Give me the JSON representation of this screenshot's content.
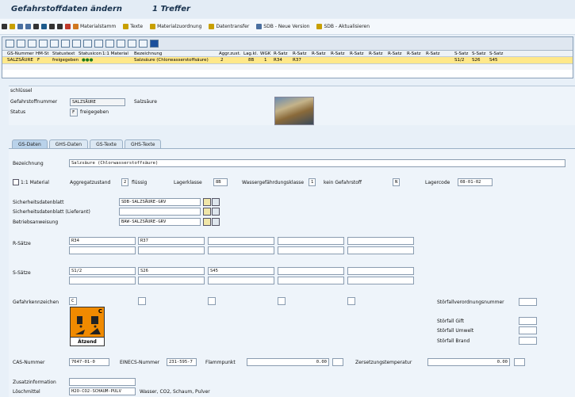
{
  "title": {
    "main": "Gefahrstoffdaten ändern",
    "count": "1 Treffer"
  },
  "toolbar": {
    "materialstamm": "Materialstamm",
    "texte": "Texte",
    "materialzuordnung": "Materialzuordnung",
    "datentransfer": "Datentransfer",
    "sdb_neue": "SDB - Neue Version",
    "sdb_akt": "SDB - Aktualisieren"
  },
  "grid": {
    "headers": [
      "GS-Nummer",
      "HM-St",
      "Statustext",
      "Statusicon",
      "1:1 Material",
      "Bezeichnung",
      "Aggr.zust.",
      "Lag.kl.",
      "WGK",
      "R-Satz",
      "R-Satz",
      "R-Satz",
      "R-Satz",
      "R-Satz",
      "R-Satz",
      "R-Satz",
      "R-Satz",
      "R-Satz",
      "S-Satz",
      "S-Satz",
      "S-Satz"
    ],
    "row": {
      "gs": "SALZSÄURE",
      "hm": "F",
      "status": "freigegeben",
      "bez": "Salzsäure (Chlorwasserstoffsäure)",
      "aggr": "2",
      "lag": "8B",
      "wgk": "1",
      "r1": "R34",
      "r2": "R37",
      "s1": "S1/2",
      "s2": "S26",
      "s3": "S45"
    }
  },
  "section": {
    "header": "schlüssel",
    "gsnr_label": "Gefahrstoffnummer",
    "gsnr": "SALZSÄURE",
    "gsnr_text": "Salzsäure",
    "status_label": "Status",
    "status": "F",
    "status_text": "freigegeben"
  },
  "tabs": [
    "GS-Daten",
    "GHS-Daten",
    "GS-Texte",
    "GHS-Texte"
  ],
  "form": {
    "bez_label": "Bezeichnung",
    "bez": "Salzsäure (Chlorwasserstoffsäure)",
    "mat_label": "1:1 Material",
    "aggr_label": "Aggregatzustand",
    "aggr": "2",
    "aggr_text": "flüssig",
    "lager_label": "Lagerklasse",
    "lager": "8B",
    "wgk_label": "Wassergefährdungsklasse",
    "wgk": "1",
    "kein_label": "kein Gefahrstoff",
    "kein": "N",
    "lagercode_label": "Lagercode",
    "lagercode": "08-01-02",
    "sdb_label": "Sicherheitsdatenblatt",
    "sdb": "SDB-SALZSÄURE-GRV",
    "sdbl_label": "Sicherheitsdatenblatt (Lieferant)",
    "sdbl": "",
    "ba_label": "Betriebsanweisung",
    "ba": "BAW-SALZSÄURE-GRV",
    "r_label": "R-Sätze",
    "r1": "R34",
    "r2": "R37",
    "s_label": "S-Sätze",
    "s1": "S1/2",
    "s2": "S26",
    "s3": "S45",
    "gk_label": "Gefahrkennzeichen",
    "gk": "C",
    "hazard_letter": "C",
    "hazard_text": "Ätzend",
    "stoerfall_vo": "Störfallverordnungsnummer",
    "stoer_gift": "Störfall Gift",
    "stoer_umwelt": "Störfall Umwelt",
    "stoer_brand": "Störfall Brand",
    "cas_label": "CAS-Nummer",
    "cas": "7647-01-0",
    "einecs_label": "EINECS-Nummer",
    "einecs": "231-595-7",
    "flamm_label": "Flammpunkt",
    "flamm": "0.00",
    "zers_label": "Zersetzungstemperatur",
    "zers": "0.00",
    "zusatz_label": "Zusatzinformation",
    "loesch_label": "Löschmittel",
    "loesch": "H2O-CO2-SCHAUM-PULV",
    "loesch_text": "Wasser, CO2, Schaum, Pulver"
  },
  "colors": {
    "hazard_orange": "#f08a00",
    "row_highlight": "#ffe88a",
    "background": "#eef4fa"
  }
}
